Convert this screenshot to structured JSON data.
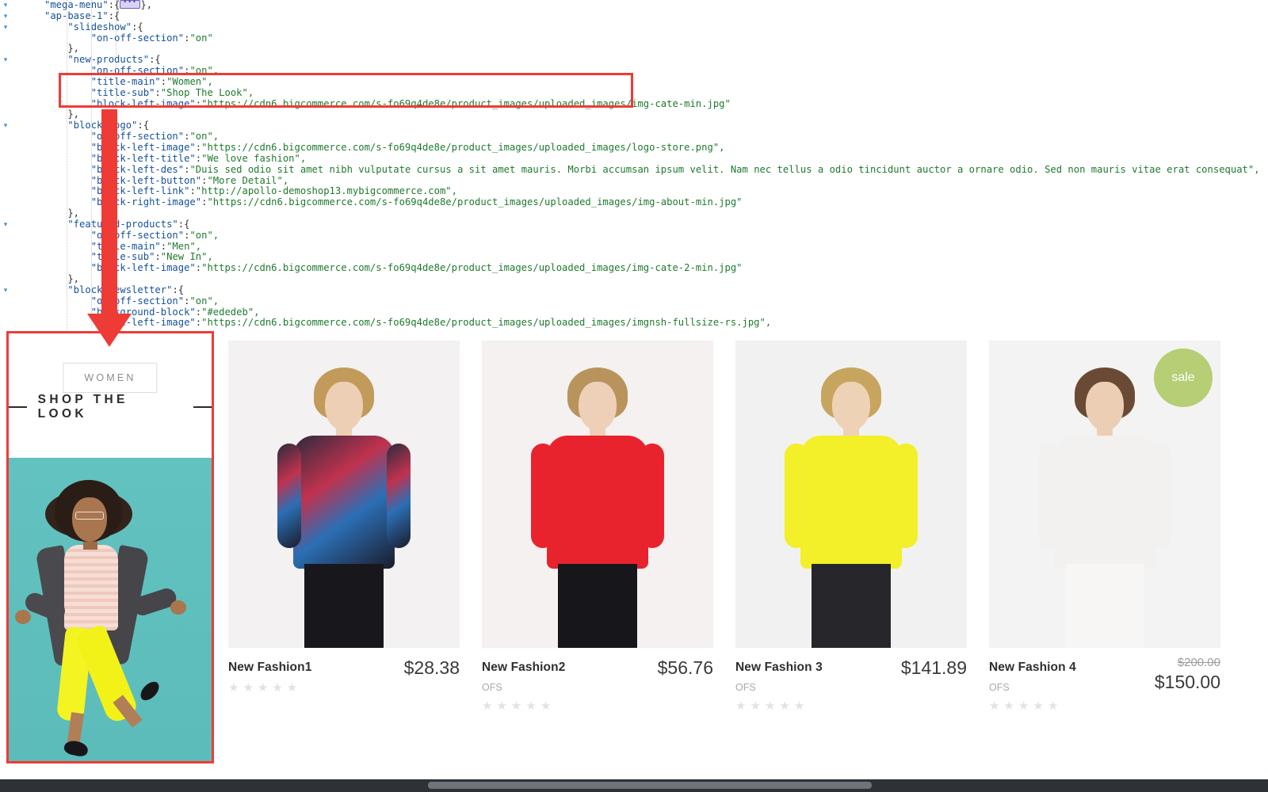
{
  "editor": {
    "language": "json",
    "collapsed_marker_label": "mega-menu collapsed object",
    "lines": [
      [
        {
          "t": "\"mega-menu\"",
          "c": "k"
        },
        {
          "t": ":{",
          "c": "p"
        },
        {
          "t": "@FOLD@",
          "c": "fold"
        },
        {
          "t": "},",
          "c": "p"
        }
      ],
      [
        {
          "t": "\"ap-base-1\"",
          "c": "k"
        },
        {
          "t": ":{",
          "c": "p"
        }
      ],
      [
        {
          "t": "    \"slideshow\"",
          "c": "k"
        },
        {
          "t": ":{",
          "c": "p"
        }
      ],
      [
        {
          "t": "        \"on-off-section\"",
          "c": "k"
        },
        {
          "t": ":",
          "c": "p"
        },
        {
          "t": "\"on\"",
          "c": "v"
        }
      ],
      [
        {
          "t": "    },",
          "c": "p"
        }
      ],
      [
        {
          "t": "    \"new-products\"",
          "c": "k"
        },
        {
          "t": ":{",
          "c": "p"
        }
      ],
      [
        {
          "t": "        \"on-off-section\"",
          "c": "k"
        },
        {
          "t": ":",
          "c": "p"
        },
        {
          "t": "\"on\",",
          "c": "v"
        }
      ],
      [
        {
          "t": "        \"title-main\"",
          "c": "k"
        },
        {
          "t": ":",
          "c": "p"
        },
        {
          "t": "\"Women\",",
          "c": "v"
        }
      ],
      [
        {
          "t": "        \"title-sub\"",
          "c": "k"
        },
        {
          "t": ":",
          "c": "p"
        },
        {
          "t": "\"Shop The Look\",",
          "c": "v"
        }
      ],
      [
        {
          "t": "        \"block-left-image\"",
          "c": "k"
        },
        {
          "t": ":",
          "c": "p"
        },
        {
          "t": "\"https://cdn6.bigcommerce.com/s-fo69q4de8e/product_images/uploaded_images/img-cate-min.jpg\"",
          "c": "v"
        }
      ],
      [
        {
          "t": "    },",
          "c": "p"
        }
      ],
      [
        {
          "t": "    \"block-logo\"",
          "c": "k"
        },
        {
          "t": ":{",
          "c": "p"
        }
      ],
      [
        {
          "t": "        \"on-off-section\"",
          "c": "k"
        },
        {
          "t": ":",
          "c": "p"
        },
        {
          "t": "\"on\",",
          "c": "v"
        }
      ],
      [
        {
          "t": "        \"block-left-image\"",
          "c": "k"
        },
        {
          "t": ":",
          "c": "p"
        },
        {
          "t": "\"https://cdn6.bigcommerce.com/s-fo69q4de8e/product_images/uploaded_images/logo-store.png\",",
          "c": "v"
        }
      ],
      [
        {
          "t": "        \"block-left-title\"",
          "c": "k"
        },
        {
          "t": ":",
          "c": "p"
        },
        {
          "t": "\"We love fashion\",",
          "c": "v"
        }
      ],
      [
        {
          "t": "        \"block-left-des\"",
          "c": "k"
        },
        {
          "t": ":",
          "c": "p"
        },
        {
          "t": "\"Duis sed odio sit amet nibh vulputate cursus a sit amet mauris. Morbi accumsan ipsum velit. Nam nec tellus a odio tincidunt auctor a ornare odio. Sed non mauris vitae erat consequat\",",
          "c": "v"
        }
      ],
      [
        {
          "t": "        \"block-left-button\"",
          "c": "k"
        },
        {
          "t": ":",
          "c": "p"
        },
        {
          "t": "\"More Detail\",",
          "c": "v"
        }
      ],
      [
        {
          "t": "        \"block-left-link\"",
          "c": "k"
        },
        {
          "t": ":",
          "c": "p"
        },
        {
          "t": "\"http://apollo-demoshop13.mybigcommerce.com\",",
          "c": "v"
        }
      ],
      [
        {
          "t": "        \"block-right-image\"",
          "c": "k"
        },
        {
          "t": ":",
          "c": "p"
        },
        {
          "t": "\"https://cdn6.bigcommerce.com/s-fo69q4de8e/product_images/uploaded_images/img-about-min.jpg\"",
          "c": "v"
        }
      ],
      [
        {
          "t": "    },",
          "c": "p"
        }
      ],
      [
        {
          "t": "    \"featured-products\"",
          "c": "k"
        },
        {
          "t": ":{",
          "c": "p"
        }
      ],
      [
        {
          "t": "        \"on-off-section\"",
          "c": "k"
        },
        {
          "t": ":",
          "c": "p"
        },
        {
          "t": "\"on\",",
          "c": "v"
        }
      ],
      [
        {
          "t": "        \"title-main\"",
          "c": "k"
        },
        {
          "t": ":",
          "c": "p"
        },
        {
          "t": "\"Men\",",
          "c": "v"
        }
      ],
      [
        {
          "t": "        \"title-sub\"",
          "c": "k"
        },
        {
          "t": ":",
          "c": "p"
        },
        {
          "t": "\"New In\",",
          "c": "v"
        }
      ],
      [
        {
          "t": "        \"block-left-image\"",
          "c": "k"
        },
        {
          "t": ":",
          "c": "p"
        },
        {
          "t": "\"https://cdn6.bigcommerce.com/s-fo69q4de8e/product_images/uploaded_images/img-cate-2-min.jpg\"",
          "c": "v"
        }
      ],
      [
        {
          "t": "    },",
          "c": "p"
        }
      ],
      [
        {
          "t": "    \"block-newsletter\"",
          "c": "k"
        },
        {
          "t": ":{",
          "c": "p"
        }
      ],
      [
        {
          "t": "        \"on-off-section\"",
          "c": "k"
        },
        {
          "t": ":",
          "c": "p"
        },
        {
          "t": "\"on\",",
          "c": "v"
        }
      ],
      [
        {
          "t": "        \"background-block\"",
          "c": "k"
        },
        {
          "t": ":",
          "c": "p"
        },
        {
          "t": "\"#ededeb\",",
          "c": "v"
        }
      ],
      [
        {
          "t": "        \"email-left-image\"",
          "c": "k"
        },
        {
          "t": ":",
          "c": "p"
        },
        {
          "t": "\"https://cdn6.bigcommerce.com/s-fo69q4de8e/product_images/uploaded_images/imgnsh-fullsize-rs.jpg\",",
          "c": "v"
        }
      ]
    ],
    "fold_arrow_glyph": "▾",
    "fold_rows": [
      0,
      1,
      2,
      5,
      11,
      20,
      26
    ],
    "key_color": "#14519c",
    "value_color": "#1f7a2e"
  },
  "annotations": {
    "box_color": "#ef3b36",
    "arrow_color": "#ef3b36",
    "code_highlight_keys": [
      "title-main",
      "title-sub",
      "block-left-image"
    ],
    "target_label": "shop-the-look-block"
  },
  "storefront": {
    "shop_look": {
      "button_label": "WOMEN",
      "title": "SHOP THE LOOK",
      "photo_bg": "#5fbfbd"
    },
    "products": [
      {
        "name": "New Fashion1",
        "brand": "",
        "price": "$28.38",
        "old_price": "",
        "rating": 0,
        "stars": 5,
        "badge": "",
        "image_desc": "model in floral geometric top"
      },
      {
        "name": "New Fashion2",
        "brand": "OFS",
        "price": "$56.76",
        "old_price": "",
        "rating": 0,
        "stars": 5,
        "badge": "",
        "image_desc": "model in red short-sleeve top"
      },
      {
        "name": "New Fashion 3",
        "brand": "OFS",
        "price": "$141.89",
        "old_price": "",
        "rating": 0,
        "stars": 5,
        "badge": "",
        "image_desc": "model in yellow sleeveless top, back view"
      },
      {
        "name": "New Fashion 4",
        "brand": "OFS",
        "price": "$150.00",
        "old_price": "$200.00",
        "rating": 0,
        "stars": 5,
        "badge": "sale",
        "badge_color": "#b6ce74",
        "image_desc": "model in white crop top and white trousers"
      }
    ],
    "star_glyph": "★"
  }
}
